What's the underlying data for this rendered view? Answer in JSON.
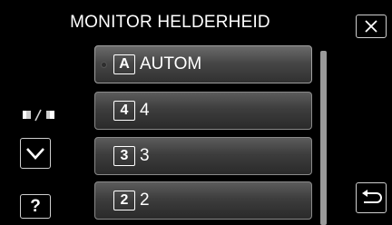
{
  "header": {
    "title": "MONITOR HELDERHEID"
  },
  "menu": {
    "items": [
      {
        "badge": "A",
        "label": "AUTOM",
        "selected": true
      },
      {
        "badge": "4",
        "label": "4",
        "selected": false
      },
      {
        "badge": "3",
        "label": "3",
        "selected": false
      },
      {
        "badge": "2",
        "label": "2",
        "selected": false
      }
    ]
  },
  "controls": {
    "help_label": "?",
    "icons": {
      "close": "close-icon",
      "ratio": "aspect-ratio-icon",
      "down": "chevron-down-icon",
      "back": "return-icon"
    }
  },
  "colors": {
    "background": "#000000",
    "button_border": "#cfcfcf",
    "item_fill": "#3d3d3d",
    "scrollbar": "#9a9a9a"
  }
}
